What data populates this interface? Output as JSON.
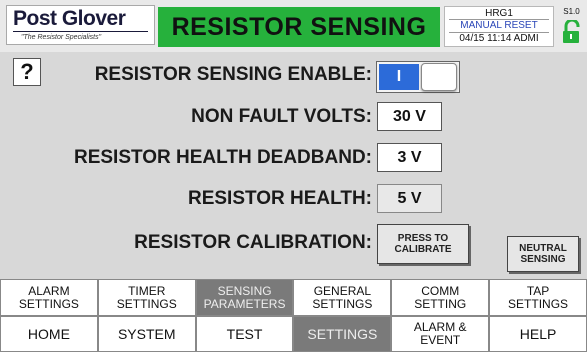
{
  "header": {
    "brand": "Post Glover",
    "tagline": "\"The Resistor Specialists\"",
    "title": "RESISTOR SENSING",
    "unit": "HRG1",
    "mode": "MANUAL RESET",
    "datetime": "04/15 11:14 ADMI",
    "station": "S1.0",
    "lock_icon": "unlocked-padlock-icon",
    "colors": {
      "title_bg": "#26b13c",
      "mode_text": "#2a46b8",
      "lock": "#26b13c"
    }
  },
  "help": {
    "label": "?"
  },
  "fields": {
    "enable_label": "RESISTOR SENSING ENABLE:",
    "enable_value": "I",
    "non_fault_label": "NON FAULT VOLTS:",
    "non_fault_value": "30 V",
    "deadband_label": "RESISTOR HEALTH DEADBAND:",
    "deadband_value": "3 V",
    "health_label": "RESISTOR HEALTH:",
    "health_value": "5 V",
    "calibration_label": "RESISTOR CALIBRATION:"
  },
  "buttons": {
    "calibrate_line1": "PRESS TO",
    "calibrate_line2": "CALIBRATE",
    "neutral_line1": "NEUTRAL",
    "neutral_line2": "SENSING"
  },
  "tabs": [
    {
      "line1": "ALARM",
      "line2": "SETTINGS",
      "active": false
    },
    {
      "line1": "TIMER",
      "line2": "SETTINGS",
      "active": false
    },
    {
      "line1": "SENSING",
      "line2": "PARAMETERS",
      "active": true
    },
    {
      "line1": "GENERAL",
      "line2": "SETTINGS",
      "active": false
    },
    {
      "line1": "COMM",
      "line2": "SETTING",
      "active": false
    },
    {
      "line1": "TAP",
      "line2": "SETTINGS",
      "active": false
    }
  ],
  "nav": [
    {
      "line1": "HOME",
      "line2": "",
      "active": false
    },
    {
      "line1": "SYSTEM",
      "line2": "",
      "active": false
    },
    {
      "line1": "TEST",
      "line2": "",
      "active": false
    },
    {
      "line1": "SETTINGS",
      "line2": "",
      "active": true
    },
    {
      "line1": "ALARM &",
      "line2": "EVENT",
      "active": false
    },
    {
      "line1": "HELP",
      "line2": "",
      "active": false
    }
  ]
}
